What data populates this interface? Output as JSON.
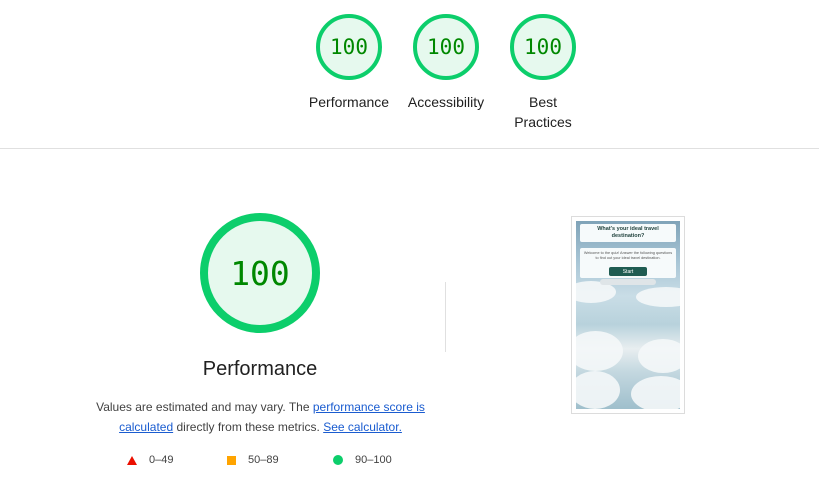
{
  "summary_gauges": [
    {
      "score": "100",
      "label": "Performance"
    },
    {
      "score": "100",
      "label": "Accessibility"
    },
    {
      "score": "100",
      "label": "Best Practices"
    }
  ],
  "main": {
    "score": "100",
    "title": "Performance",
    "description": {
      "text_1": "Values are estimated and may vary. The ",
      "link_1": "performance score is calculated",
      "text_2": " directly from these metrics. ",
      "link_2": "See calculator."
    },
    "legend": [
      {
        "range": "0–49",
        "color": "#eb0f00",
        "shape": "triangle"
      },
      {
        "range": "50–89",
        "color": "#ffa400",
        "shape": "square"
      },
      {
        "range": "90–100",
        "color": "#0cce6b",
        "shape": "circle"
      }
    ]
  },
  "preview": {
    "heading": "What's your ideal travel destination?",
    "body": "Welcome to the quiz! Answer the following questions to find out your ideal travel destination.",
    "button": "Start"
  },
  "colors": {
    "pass": "#0cce6b",
    "pass_text": "#008800",
    "link": "#1a5cd0"
  }
}
